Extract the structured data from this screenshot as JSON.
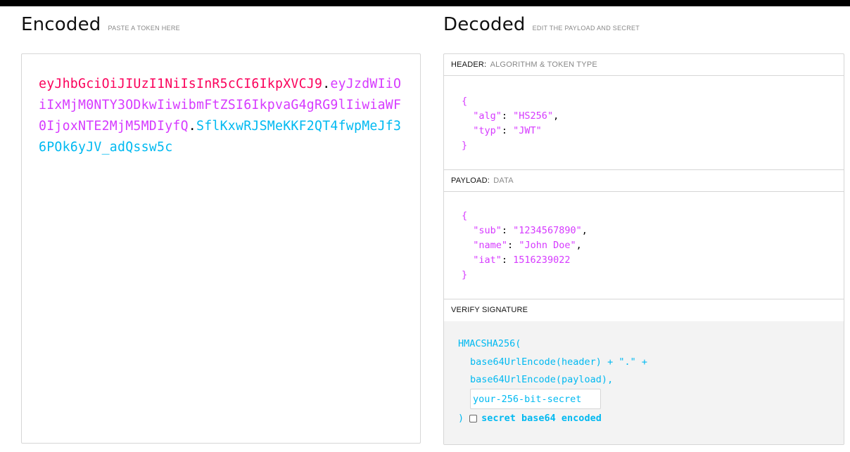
{
  "encoded": {
    "title": "Encoded",
    "hint": "PASTE A TOKEN HERE",
    "token": {
      "header": "eyJhbGciOiJIUzI1NiIsInR5cCI6IkpXVCJ9",
      "payload": "eyJzdWIiOiIxMjM0NTY3ODkwIiwibmFtZSI6IkpvaG4gRG9lIiwiaWF0IjoxNTE2MjM5MDIyfQ",
      "signature": "SflKxwRJSMeKKF2QT4fwpMeJf36POk6yJV_adQssw5c",
      "dot": "."
    }
  },
  "decoded": {
    "title": "Decoded",
    "hint": "EDIT THE PAYLOAD AND SECRET",
    "header_section": {
      "label": "HEADER:",
      "sub": "ALGORITHM & TOKEN TYPE",
      "open": "{",
      "close": "}",
      "fields": [
        {
          "key": "\"alg\"",
          "value": "\"HS256\"",
          "comma": ","
        },
        {
          "key": "\"typ\"",
          "value": "\"JWT\"",
          "comma": ""
        }
      ]
    },
    "payload_section": {
      "label": "PAYLOAD:",
      "sub": "DATA",
      "open": "{",
      "close": "}",
      "fields": [
        {
          "key": "\"sub\"",
          "value": "\"1234567890\"",
          "comma": ","
        },
        {
          "key": "\"name\"",
          "value": "\"John Doe\"",
          "comma": ","
        },
        {
          "key": "\"iat\"",
          "value": "1516239022",
          "comma": ""
        }
      ]
    },
    "signature_section": {
      "label": "VERIFY SIGNATURE",
      "fn_open": "HMACSHA256(",
      "line1": "base64UrlEncode(header) + \".\" +",
      "line2": "base64UrlEncode(payload),",
      "secret_placeholder": "your-256-bit-secret",
      "fn_close": ")",
      "checkbox_label": "secret base64 encoded",
      "checkbox_checked": false
    }
  },
  "colors": {
    "header": "#fb015b",
    "payload": "#d63aff",
    "signature": "#00b9f1"
  }
}
